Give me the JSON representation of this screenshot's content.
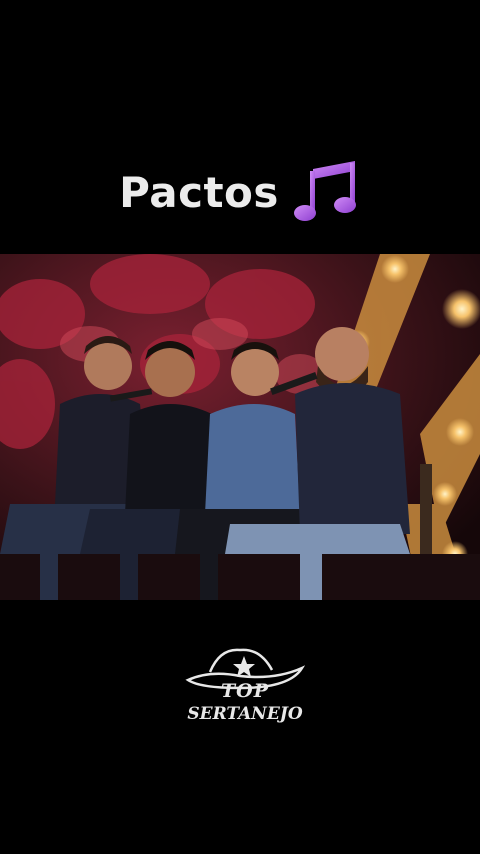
{
  "header": {
    "title": "Pactos",
    "icon": "musical-notes-icon",
    "icon_color": "#b05ee6"
  },
  "video": {
    "scene": "four performers seated on stage singing"
  },
  "logo": {
    "line1": "TOP",
    "line2": "SERTANEJO",
    "icon": "cowboy-hat-star-icon"
  },
  "colors": {
    "background": "#000000",
    "title_text": "#ececec",
    "stage_red": "#8a1f2a",
    "stage_gold": "#f3b45a"
  }
}
